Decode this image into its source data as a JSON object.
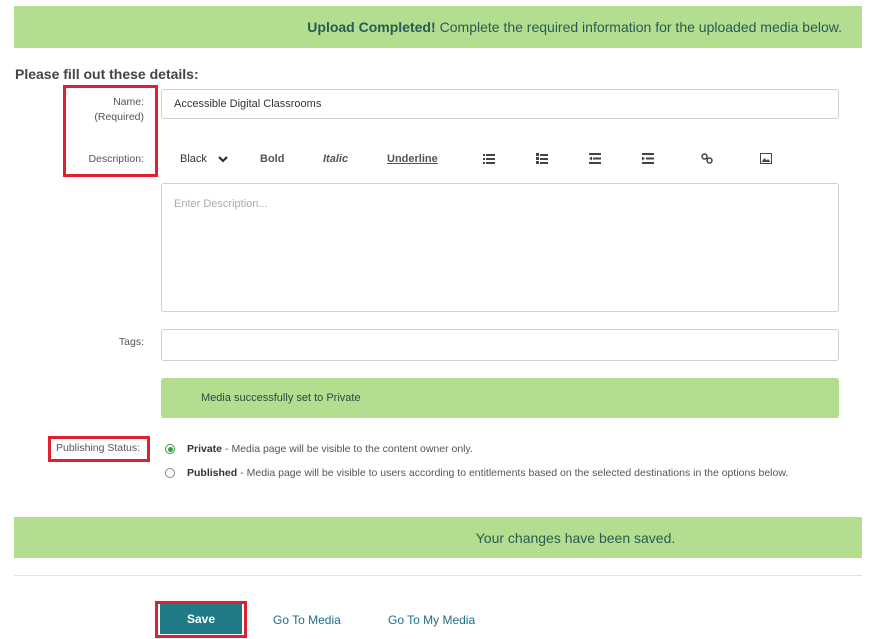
{
  "banner": {
    "strong": "Upload Completed!",
    "text": "Complete the required information for the uploaded media below."
  },
  "form": {
    "heading": "Please fill out these details:",
    "name_label": "Name:",
    "name_required": "(Required)",
    "name_value": "Accessible Digital Classrooms",
    "description_label": "Description:",
    "description_placeholder": "Enter Description...",
    "tags_label": "Tags:",
    "tags_value": ""
  },
  "toolbar": {
    "color": "Black",
    "bold": "Bold",
    "italic": "Italic",
    "underline": "Underline",
    "icons": [
      "unordered-list-icon",
      "ordered-list-icon",
      "outdent-icon",
      "indent-icon",
      "link-icon",
      "image-icon"
    ]
  },
  "status_message": "Media successfully set to Private",
  "publishing": {
    "label": "Publishing Status:",
    "private_title": "Private",
    "private_desc": " - Media page will be visible to the content owner only.",
    "published_title": "Published",
    "published_desc": " - Media page will be visible to users according to entitlements based on the selected destinations in the options below.",
    "selected": "private"
  },
  "saved_message": "Your changes have been saved.",
  "actions": {
    "save": "Save",
    "go_to_media": "Go To Media",
    "go_to_my_media": "Go To My Media"
  },
  "colors": {
    "banner_green": "#b3dd8f",
    "save_teal": "#1f7a86",
    "highlight_red": "#e0202e",
    "link_blue": "#1b6f86"
  }
}
